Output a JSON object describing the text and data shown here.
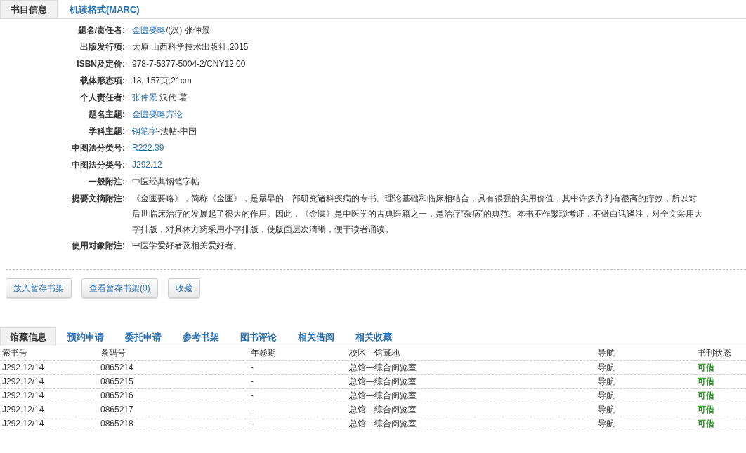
{
  "top_tabs": [
    {
      "label": "书目信息",
      "selected": true
    },
    {
      "label": "机读格式(MARC)",
      "selected": false
    }
  ],
  "fields": [
    {
      "label": "题名/责任者:",
      "parts": [
        {
          "text": "金匮要略",
          "link": true
        },
        {
          "text": "/(汉) 张仲景",
          "link": false
        }
      ]
    },
    {
      "label": "出版发行项:",
      "parts": [
        {
          "text": "太原:山西科学技术出版社,2015",
          "link": false
        }
      ]
    },
    {
      "label": "ISBN及定价:",
      "parts": [
        {
          "text": "978-7-5377-5004-2/CNY12.00",
          "link": false
        }
      ]
    },
    {
      "label": "载体形态项:",
      "parts": [
        {
          "text": "18, 157页;21cm",
          "link": false
        }
      ]
    },
    {
      "label": "个人责任者:",
      "parts": [
        {
          "text": "张仲景",
          "link": true
        },
        {
          "text": " 汉代 著",
          "link": false
        }
      ]
    },
    {
      "label": "题名主题:",
      "parts": [
        {
          "text": "金匮要略方论",
          "link": true
        }
      ]
    },
    {
      "label": "学科主题:",
      "parts": [
        {
          "text": "钢笔字",
          "link": true
        },
        {
          "text": "-法帖-中国",
          "link": false
        }
      ]
    },
    {
      "label": "中图法分类号:",
      "parts": [
        {
          "text": "R222.39",
          "link": true
        }
      ]
    },
    {
      "label": "中图法分类号:",
      "parts": [
        {
          "text": "J292.12",
          "link": true
        }
      ]
    },
    {
      "label": "一般附注:",
      "parts": [
        {
          "text": "中医经典钢笔字帖",
          "link": false
        }
      ]
    },
    {
      "label": "提要文摘附注:",
      "parts": [
        {
          "text": "《金匮要略》，简称《金匮》，是最早的一部研究诸科疾病的专书。理论基础和临床相结合，具有很强的实用价值，其中许多方剂有很高的疗效，所以对后世临床治疗的发展起了很大的作用。因此，《金匮》是中医学的古典医籍之一，是治疗“杂病”的典范。本书不作繁琐考证，不做白话译注，对全文采用大字排版，对具体方药采用小字排版，使版面层次清晰，便于读者诵读。",
          "link": false
        }
      ]
    },
    {
      "label": "使用对象附注:",
      "parts": [
        {
          "text": "中医学爱好者及相关爱好者。",
          "link": false
        }
      ]
    }
  ],
  "buttons": [
    "放入暂存书架",
    "查看暂存书架(0)",
    "收藏"
  ],
  "holdings_tabs": [
    {
      "label": "馆藏信息",
      "selected": true
    },
    {
      "label": "预约申请",
      "selected": false
    },
    {
      "label": "委托申请",
      "selected": false
    },
    {
      "label": "参考书架",
      "selected": false
    },
    {
      "label": "图书评论",
      "selected": false
    },
    {
      "label": "相关借阅",
      "selected": false
    },
    {
      "label": "相关收藏",
      "selected": false
    }
  ],
  "table": {
    "columns": [
      "索书号",
      "条码号",
      "年卷期",
      "校区—馆藏地",
      "导航",
      "书刊状态"
    ],
    "rows": [
      [
        "J292.12/14",
        "0865214",
        "-",
        "总馆—综合阅览室",
        "导航",
        "可借"
      ],
      [
        "J292.12/14",
        "0865215",
        "-",
        "总馆—综合阅览室",
        "导航",
        "可借"
      ],
      [
        "J292.12/14",
        "0865216",
        "-",
        "总馆—综合阅览室",
        "导航",
        "可借"
      ],
      [
        "J292.12/14",
        "0865217",
        "-",
        "总馆—综合阅览室",
        "导航",
        "可借"
      ],
      [
        "J292.12/14",
        "0865218",
        "-",
        "总馆—综合阅览室",
        "导航",
        "可借"
      ]
    ]
  }
}
